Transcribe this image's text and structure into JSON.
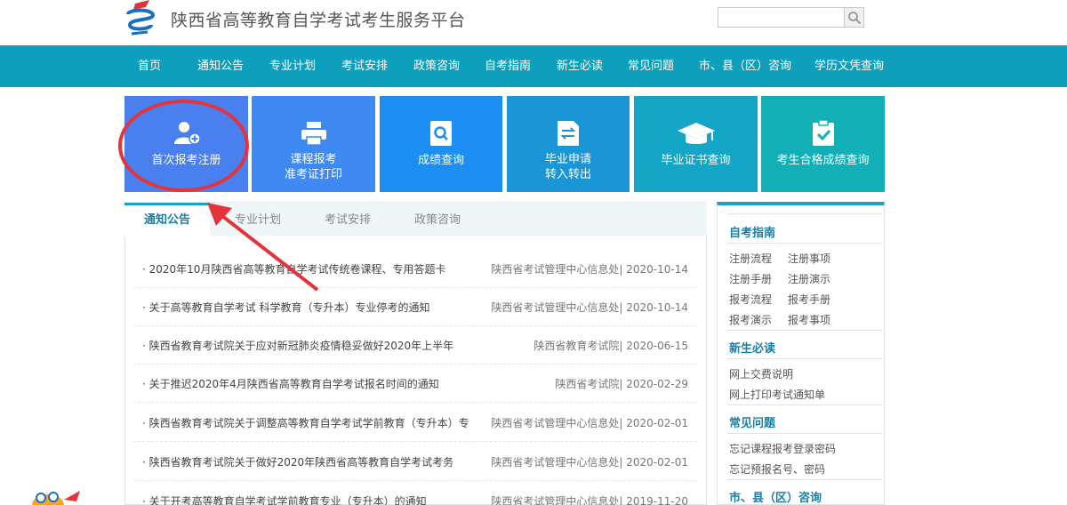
{
  "header": {
    "site_title": "陕西省高等教育自学考试考生服务平台",
    "search_placeholder": ""
  },
  "nav": [
    "首页",
    "通知公告",
    "专业计划",
    "考试安排",
    "政策咨询",
    "自考指南",
    "新生必读",
    "常见问题",
    "市、县（区）咨询",
    "学历文凭查询"
  ],
  "tiles": [
    {
      "lines": [
        "首次报考注册"
      ],
      "icon": "user-add-icon",
      "color": "#4a7ff0"
    },
    {
      "lines": [
        "课程报考",
        "准考证打印"
      ],
      "icon": "printer-icon",
      "color": "#3f89f2"
    },
    {
      "lines": [
        "成绩查询"
      ],
      "icon": "search-document-icon",
      "color": "#1d8ef3"
    },
    {
      "lines": [
        "毕业申请",
        "转入转出"
      ],
      "icon": "transfer-document-icon",
      "color": "#1a95d6"
    },
    {
      "lines": [
        "毕业证书查询"
      ],
      "icon": "graduation-cap-icon",
      "color": "#13a6c7"
    },
    {
      "lines": [
        "考生合格成绩查询"
      ],
      "icon": "clipboard-check-icon",
      "color": "#12b0b6"
    }
  ],
  "tabs": [
    "通知公告",
    "专业计划",
    "考试安排",
    "政策咨询"
  ],
  "news": [
    {
      "title": "· 2020年10月陕西省高等教育自学考试传统卷课程、专用答题卡",
      "meta": "陕西省考试管理中心信息处| 2020-10-14"
    },
    {
      "title": "· 关于高等教育自学考试 科学教育（专升本）专业停考的通知",
      "meta": "陕西省考试管理中心信息处| 2020-10-14"
    },
    {
      "title": "· 陕西省教育考试院关于应对新冠肺炎疫情稳妥做好2020年上半年",
      "meta": "陕西省教育考试院| 2020-06-15"
    },
    {
      "title": "· 关于推迟2020年4月陕西省高等教育自学考试报名时间的通知",
      "meta": "陕西省考试院| 2020-02-29"
    },
    {
      "title": "· 陕西省教育考试院关于调整高等教育自学考试学前教育（专升本）专",
      "meta": "陕西省考试管理中心信息处| 2020-02-01"
    },
    {
      "title": "· 陕西省教育考试院关于做好2020年陕西省高等教育自学考试考务",
      "meta": "陕西省考试管理中心信息处| 2020-02-01"
    },
    {
      "title": "· 关于开考高等教育自学考试学前教育专业（专升本）的通知",
      "meta": "陕西省考试管理中心信息处| 2019-11-20"
    }
  ],
  "sidebar": {
    "guide": {
      "title": "自考指南",
      "links": [
        [
          "注册流程",
          "注册事项"
        ],
        [
          "注册手册",
          "注册演示"
        ],
        [
          "报考流程",
          "报考手册"
        ],
        [
          "报考演示",
          "报考事项"
        ]
      ]
    },
    "newbie": {
      "title": "新生必读",
      "links": [
        "网上交费说明",
        "网上打印考试通知单"
      ]
    },
    "faq": {
      "title": "常见问题",
      "links": [
        "忘记课程报考登录密码",
        "忘记预报名号、密码"
      ]
    },
    "county": {
      "title": "市、县（区）咨询"
    }
  },
  "colors": {
    "nav_bg": "#0e9fbc",
    "accent": "#1a7fa8",
    "annotation_red": "#e5333a"
  }
}
